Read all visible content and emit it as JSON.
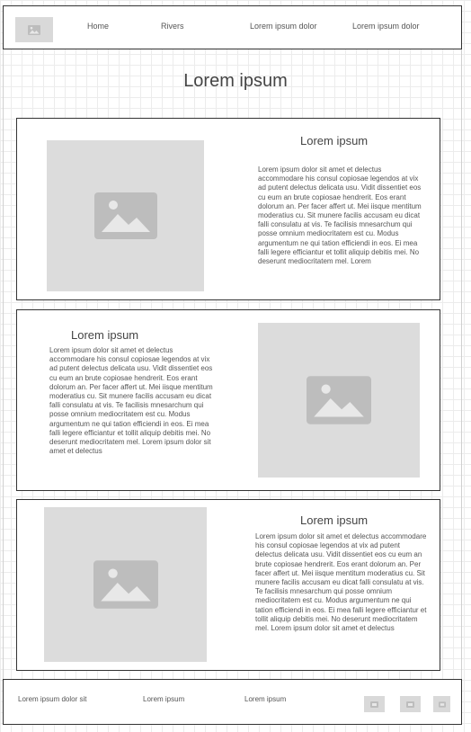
{
  "header": {
    "nav": [
      "Home",
      "Rivers",
      "Lorem ipsum dolor",
      "Lorem ipsum dolor"
    ]
  },
  "page_title": "Lorem ipsum",
  "cards": [
    {
      "heading": "Lorem ipsum",
      "body": "Lorem ipsum dolor sit amet et delectus accommodare his consul copiosae legendos at vix ad putent delectus delicata usu. Vidit dissentiet eos cu eum an brute copiosae hendrerit. Eos erant dolorum an. Per facer affert ut. Mei iisque mentitum moderatius cu. Sit munere facilis accusam eu dicat falli consulatu at vis. Te facilisis mnesarchum qui posse omnium mediocritatem est cu. Modus argumentum ne qui tation efficiendi in eos. Ei mea falli legere efficiantur et tollit aliquip debitis mei. No deserunt mediocritatem mel. Lorem"
    },
    {
      "heading": "Lorem ipsum",
      "body": "Lorem ipsum dolor sit amet et delectus accommodare his consul copiosae legendos at vix ad putent delectus delicata usu. Vidit dissentiet eos cu eum an brute copiosae hendrerit. Eos erant dolorum an. Per facer affert ut. Mei iisque mentitum moderatius cu. Sit munere facilis accusam eu dicat falli consulatu at vis. Te facilisis mnesarchum qui posse omnium mediocritatem est cu. Modus argumentum ne qui tation efficiendi in eos. Ei mea falli legere efficiantur et tollit aliquip debitis mei. No deserunt mediocritatem mel. Lorem ipsum dolor sit amet et delectus"
    },
    {
      "heading": "Lorem ipsum",
      "body": "Lorem ipsum dolor sit amet et delectus accommodare his consul copiosae legendos at vix ad putent delectus delicata usu. Vidit dissentiet eos cu eum an brute copiosae hendrerit. Eos erant dolorum an. Per facer affert ut. Mei iisque mentitum moderatius cu. Sit munere facilis accusam eu dicat falli consulatu at vis. Te facilisis mnesarchum qui posse omnium mediocritatem est cu. Modus argumentum ne qui tation efficiendi in eos. Ei mea falli legere efficiantur et tollit aliquip debitis mei. No deserunt mediocritatem mel. Lorem ipsum dolor sit amet et delectus"
    }
  ],
  "footer": {
    "links": [
      "Lorem ipsum dolor sit",
      "Lorem ipsum",
      "Lorem ipsum"
    ],
    "icons": [
      "social-icon",
      "social-icon",
      "social-icon"
    ]
  },
  "colors": {
    "placeholder": "#dcdcdc",
    "placeholder_icon": "#bdbdbd",
    "border": "#333333",
    "grid": "#ececec"
  }
}
